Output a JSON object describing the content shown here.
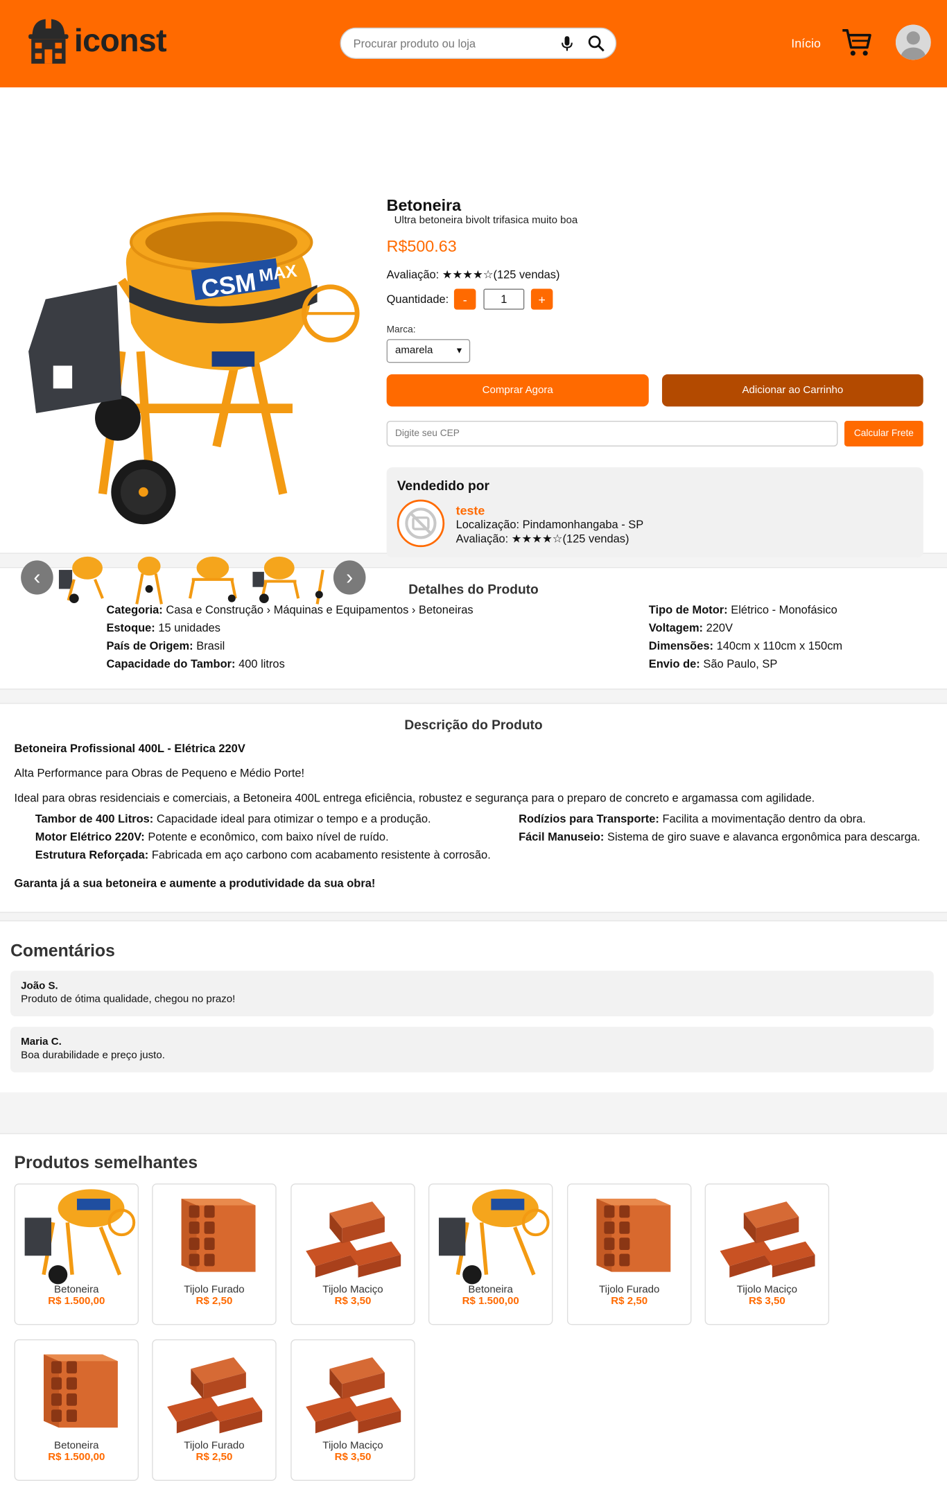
{
  "header": {
    "logo_text": "iconst",
    "search_placeholder": "Procurar produto ou loja",
    "nav_home": "Início"
  },
  "product": {
    "title": "Betoneira",
    "subtitle": "Ultra betoneira bivolt trifasica muito boa",
    "price": "R$500.63",
    "rating_label": "Avaliação:",
    "rating_text": "★★★★☆(125 vendas)",
    "quantity_label": "Quantidade:",
    "quantity": "1",
    "qty_minus": "-",
    "qty_plus": "+",
    "brand_label": "Marca:",
    "brand_selected": "amarela",
    "buy_label": "Comprar Agora",
    "add_cart_label": "Adicionar ao Carrinho",
    "cep_placeholder": "Digite seu CEP",
    "freight_label": "Calcular Frete",
    "logo_lettering": "CSM MAX"
  },
  "gallery": {
    "prev": "‹",
    "next": "›"
  },
  "seller": {
    "title": "Vendedido por",
    "name": "teste",
    "location_label": "Localização:",
    "location": "Pindamonhangaba - SP",
    "rating_label": "Avaliação:",
    "rating_text": "★★★★☆(125 vendas)"
  },
  "details": {
    "title": "Detalhes do Produto",
    "left": [
      {
        "k": "Categoria:",
        "v": "Casa e Construção › Máquinas e Equipamentos › Betoneiras"
      },
      {
        "k": "Estoque:",
        "v": "15 unidades"
      },
      {
        "k": "País de Origem:",
        "v": "Brasil"
      },
      {
        "k": "Capacidade do Tambor:",
        "v": "400 litros"
      }
    ],
    "right": [
      {
        "k": "Tipo de Motor:",
        "v": "Elétrico - Monofásico"
      },
      {
        "k": "Voltagem:",
        "v": "220V"
      },
      {
        "k": "Dimensões:",
        "v": "140cm x 110cm x 150cm"
      },
      {
        "k": "Envio de:",
        "v": "São Paulo, SP"
      }
    ]
  },
  "description": {
    "title": "Descrição do Produto",
    "heading": "Betoneira Profissional 400L - Elétrica 220V",
    "line1": "Alta Performance para Obras de Pequeno e Médio Porte!",
    "line2": "Ideal para obras residenciais e comerciais, a Betoneira 400L entrega eficiência, robustez e segurança para o preparo de concreto e argamassa com agilidade.",
    "features_left": [
      {
        "k": "Tambor de 400 Litros:",
        "v": "Capacidade ideal para otimizar o tempo e a produção."
      },
      {
        "k": "Motor Elétrico 220V:",
        "v": "Potente e econômico, com baixo nível de ruído."
      },
      {
        "k": "Estrutura Reforçada:",
        "v": "Fabricada em aço carbono com acabamento resistente à corrosão."
      }
    ],
    "features_right": [
      {
        "k": "Rodízios para Transporte:",
        "v": "Facilita a movimentação dentro da obra."
      },
      {
        "k": "Fácil Manuseio:",
        "v": "Sistema de giro suave e alavanca ergonômica para descarga."
      }
    ],
    "closing": "Garanta já a sua betoneira e aumente a produtividade da sua obra!"
  },
  "comments": {
    "title": "Comentários",
    "items": [
      {
        "name": "João S.",
        "text": "Produto de ótima qualidade, chegou no prazo!"
      },
      {
        "name": "Maria C.",
        "text": "Boa durabilidade e preço justo."
      }
    ]
  },
  "similar": {
    "title": "Produtos semelhantes",
    "items": [
      {
        "name": "Betoneira",
        "price": "R$ 1.500,00",
        "img": "mixer"
      },
      {
        "name": "Tijolo Furado",
        "price": "R$ 2,50",
        "img": "brick-hollow"
      },
      {
        "name": "Tijolo Maciço",
        "price": "R$ 3,50",
        "img": "brick-solid"
      },
      {
        "name": "Betoneira",
        "price": "R$ 1.500,00",
        "img": "mixer"
      },
      {
        "name": "Tijolo Furado",
        "price": "R$ 2,50",
        "img": "brick-hollow"
      },
      {
        "name": "Tijolo Maciço",
        "price": "R$ 3,50",
        "img": "brick-solid"
      },
      {
        "name": "Betoneira",
        "price": "R$ 1.500,00",
        "img": "brick-hollow"
      },
      {
        "name": "Tijolo Furado",
        "price": "R$ 2,50",
        "img": "brick-solid"
      },
      {
        "name": "Tijolo Maciço",
        "price": "R$ 3,50",
        "img": "brick-solid"
      }
    ]
  },
  "colors": {
    "brand": "#ff6a00",
    "brand_dark": "#b34a00"
  }
}
